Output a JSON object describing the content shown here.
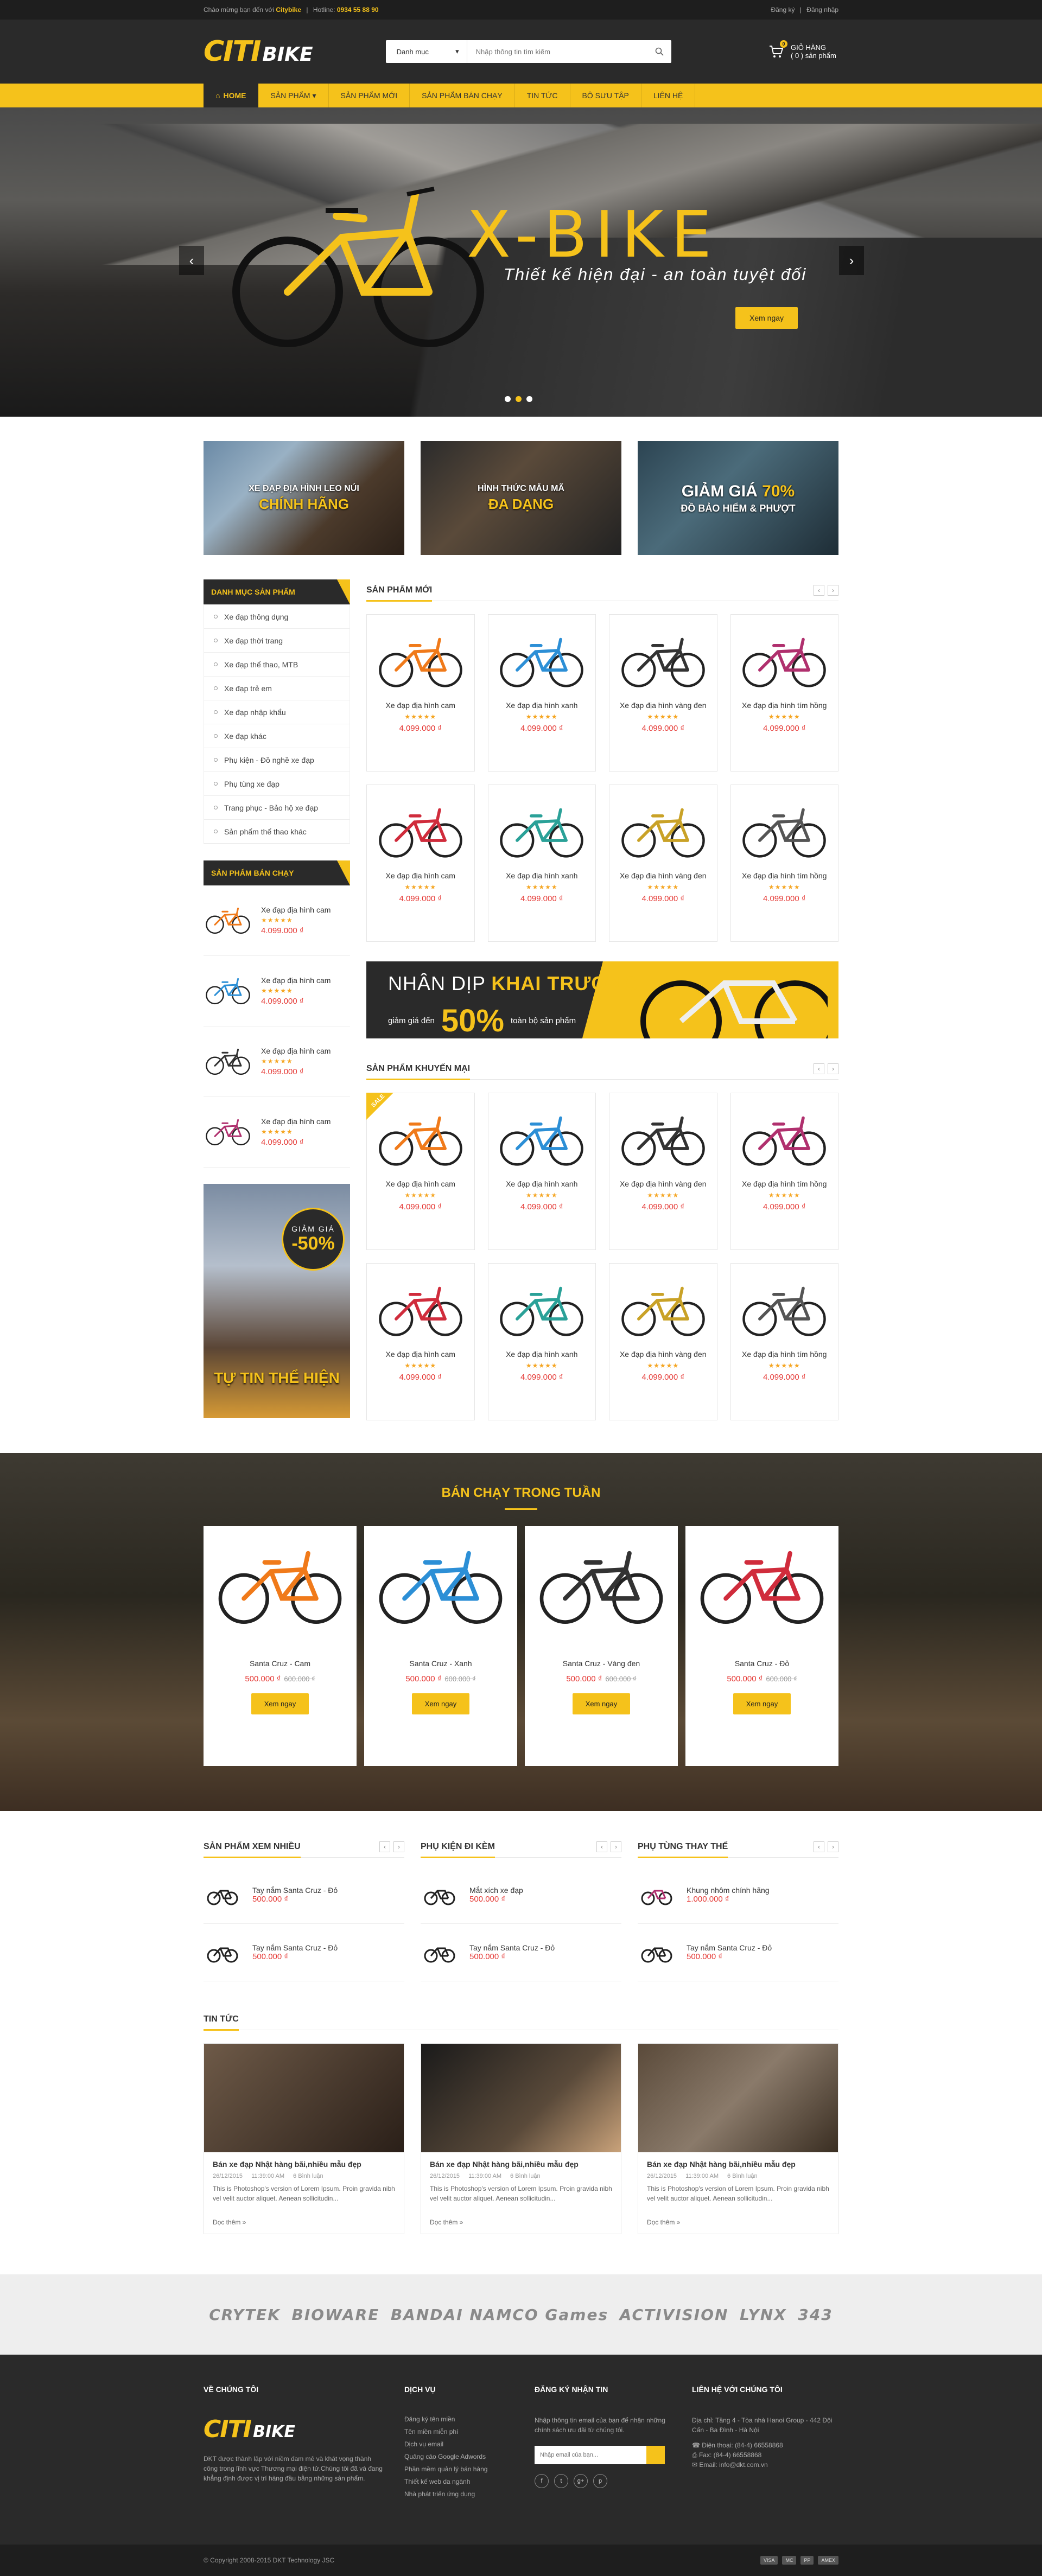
{
  "topbar": {
    "welcome": "Chào mừng bạn đến với ",
    "brand": "Citybike",
    "hotline_label": "Hotline: ",
    "hotline": "0934 55 88 90",
    "login": "Đăng ký",
    "register": "Đăng nhập"
  },
  "header": {
    "logo_a": "CITI",
    "logo_b": "BIKE",
    "search_category": "Danh mục",
    "search_placeholder": "Nhập thông tin tìm kiếm",
    "cart_title": "GIỎ HÀNG",
    "cart_count_text": "( 0 ) sản phẩm",
    "cart_badge": "0"
  },
  "nav": [
    "HOME",
    "SẢN PHẨM ▾",
    "SẢN PHẨM MỚI",
    "SẢN PHẨM BÁN CHẠY",
    "TIN TỨC",
    "BỘ SƯU TẬP",
    "LIÊN HỆ"
  ],
  "hero": {
    "title": "X-BIKE",
    "subtitle": "Thiết kế hiện đại - an toàn tuyệt đối",
    "button": "Xem ngay"
  },
  "banners": [
    {
      "line1": "XE ĐẠP ĐỊA HÌNH LEO NÚI",
      "line2": "CHÍNH HÃNG"
    },
    {
      "line1": "HÌNH THỨC MẪU MÃ",
      "line2": "ĐA DẠNG"
    },
    {
      "line1a": "GIẢM GIÁ ",
      "line1b": "70%",
      "line2": "ĐỒ BẢO HIỂM & PHƯỢT"
    }
  ],
  "sidebar": {
    "cat_title": "DANH MỤC SẢN PHẨM",
    "categories": [
      "Xe đạp thông dụng",
      "Xe đạp thời trang",
      "Xe đạp thể thao, MTB",
      "Xe đạp trẻ em",
      "Xe đạp nhập khẩu",
      "Xe đạp khác",
      "Phụ kiện - Đồ nghề xe đạp",
      "Phụ tùng xe đạp",
      "Trang phục - Bảo hộ xe đạp",
      "Sản phẩm thể thao khác"
    ],
    "best_title": "SẢN PHẨM BÁN CHẠY",
    "best": [
      {
        "name": "Xe đạp địa hình cam",
        "price": "4.099.000 ₫"
      },
      {
        "name": "Xe đạp địa hình cam",
        "price": "4.099.000 ₫"
      },
      {
        "name": "Xe đạp địa hình cam",
        "price": "4.099.000 ₫"
      },
      {
        "name": "Xe đạp địa hình cam",
        "price": "4.099.000 ₫"
      }
    ],
    "ad_badge_a": "GIẢM GIÁ",
    "ad_badge_b": "-50%",
    "ad_caption": "TỰ TIN THỂ HIỆN"
  },
  "new_products": {
    "title": "SẢN PHẨM MỚI",
    "items": [
      {
        "name": "Xe đạp địa hình cam",
        "price": "4.099.000 ₫"
      },
      {
        "name": "Xe đạp địa hình xanh",
        "price": "4.099.000 ₫"
      },
      {
        "name": "Xe đạp địa hình vàng đen",
        "price": "4.099.000 ₫"
      },
      {
        "name": "Xe đạp địa hình tím hồng",
        "price": "4.099.000 ₫"
      },
      {
        "name": "Xe đạp địa hình cam",
        "price": "4.099.000 ₫"
      },
      {
        "name": "Xe đạp địa hình xanh",
        "price": "4.099.000 ₫"
      },
      {
        "name": "Xe đạp địa hình vàng đen",
        "price": "4.099.000 ₫"
      },
      {
        "name": "Xe đạp địa hình tím hồng",
        "price": "4.099.000 ₫"
      }
    ]
  },
  "promo": {
    "line_a": "NHÂN DỊP ",
    "line_b": "KHAI TRƯƠNG",
    "small_a": "giảm giá đến",
    "big": "50%",
    "small_b": "toàn bộ sản phẩm"
  },
  "sale_products": {
    "title": "SẢN PHẨM KHUYẾN MẠI",
    "badge": "SALE",
    "items": [
      {
        "name": "Xe đạp địa hình cam",
        "price": "4.099.000 ₫"
      },
      {
        "name": "Xe đạp địa hình xanh",
        "price": "4.099.000 ₫"
      },
      {
        "name": "Xe đạp địa hình vàng đen",
        "price": "4.099.000 ₫"
      },
      {
        "name": "Xe đạp địa hình tím hồng",
        "price": "4.099.000 ₫"
      },
      {
        "name": "Xe đạp địa hình cam",
        "price": "4.099.000 ₫"
      },
      {
        "name": "Xe đạp địa hình xanh",
        "price": "4.099.000 ₫"
      },
      {
        "name": "Xe đạp địa hình vàng đen",
        "price": "4.099.000 ₫"
      },
      {
        "name": "Xe đạp địa hình tím hồng",
        "price": "4.099.000 ₫"
      }
    ]
  },
  "weekly": {
    "title": "BÁN CHẠY TRONG TUẦN",
    "button": "Xem ngay",
    "items": [
      {
        "name": "Santa Cruz - Cam",
        "price": "500.000 ₫",
        "old": "600.000 ₫"
      },
      {
        "name": "Santa Cruz - Xanh",
        "price": "500.000 ₫",
        "old": "600.000 ₫"
      },
      {
        "name": "Santa Cruz - Vàng đen",
        "price": "500.000 ₫",
        "old": "600.000 ₫"
      },
      {
        "name": "Santa Cruz - Đỏ",
        "price": "500.000 ₫",
        "old": "600.000 ₫"
      }
    ]
  },
  "mini_cols": [
    {
      "title": "SẢN PHẨM XEM NHIỀU",
      "items": [
        {
          "name": "Tay nắm Santa Cruz - Đỏ",
          "price": "500.000 ₫"
        },
        {
          "name": "Tay nắm Santa Cruz - Đỏ",
          "price": "500.000 ₫"
        }
      ]
    },
    {
      "title": "PHỤ KIỆN ĐI KÈM",
      "items": [
        {
          "name": "Mắt xích xe đạp",
          "price": "500.000 ₫"
        },
        {
          "name": "Tay nắm Santa Cruz - Đỏ",
          "price": "500.000 ₫"
        }
      ]
    },
    {
      "title": "PHỤ TÙNG THAY THẾ",
      "items": [
        {
          "name": "Khung nhôm chính hãng",
          "price": "1.000.000 ₫"
        },
        {
          "name": "Tay nắm Santa Cruz - Đỏ",
          "price": "500.000 ₫"
        }
      ]
    }
  ],
  "news": {
    "title": "TIN TỨC",
    "items": [
      {
        "title": "Bán xe đạp Nhật hàng bãi,nhiều mẫu đẹp",
        "date": "26/12/2015",
        "time": "11:39:00 AM",
        "views": "6 Bình luận",
        "excerpt": "This is Photoshop's version of Lorem Ipsum. Proin gravida nibh vel velit auctor aliquet. Aenean sollicitudin...",
        "more": "Đọc thêm »"
      },
      {
        "title": "Bán xe đạp Nhật hàng bãi,nhiều mẫu đẹp",
        "date": "26/12/2015",
        "time": "11:39:00 AM",
        "views": "6 Bình luận",
        "excerpt": "This is Photoshop's version of Lorem Ipsum. Proin gravida nibh vel velit auctor aliquet. Aenean sollicitudin...",
        "more": "Đọc thêm »"
      },
      {
        "title": "Bán xe đạp Nhật hàng bãi,nhiều mẫu đẹp",
        "date": "26/12/2015",
        "time": "11:39:00 AM",
        "views": "6 Bình luận",
        "excerpt": "This is Photoshop's version of Lorem Ipsum. Proin gravida nibh vel velit auctor aliquet. Aenean sollicitudin...",
        "more": "Đọc thêm »"
      }
    ]
  },
  "partners": [
    "CRYTEK",
    "BIOWARE",
    "BANDAI NAMCO Games",
    "ACTIVISION",
    "LYNX",
    "343"
  ],
  "footer": {
    "about_title": "VỀ CHÚNG TÔI",
    "about_text": "DKT được thành lập với niềm đam mê và khát vọng thành công trong lĩnh vực Thương mại điện tử.Chúng tôi đã và đang khẳng định được vị trí hàng đầu bằng những sản phẩm.",
    "service_title": "DỊCH VỤ",
    "services": [
      "Đăng ký tên miền",
      "Tên miền miễn phí",
      "Dịch vụ email",
      "Quảng cáo Google Adwords",
      "Phần mềm quản lý bán hàng",
      "Thiết kế web da ngành",
      "Nhà phát triển ứng dụng"
    ],
    "nl_title": "ĐĂNG KÝ NHẬN TIN",
    "nl_text": "Nhập thông tin email của bạn để nhận những chính sách ưu đãi từ chúng tôi.",
    "nl_placeholder": "Nhập email của bạn...",
    "contact_title": "LIÊN HỆ VỚI CHÚNG TÔI",
    "contact_addr": "Địa chỉ: Tầng 4 - Tòa nhà Hanoi Group - 442 Đội Cấn - Ba Đình - Hà Nội",
    "contact_hotline": "Điện thoại: (84-4) 66558868",
    "contact_fax": "Fax: (84-4) 66558868",
    "contact_email": "Email: info@dkt.com.vn",
    "copyright": "© Copyright 2008-2015 DKT Technology JSC"
  },
  "colors": {
    "accent": "#f5c21b",
    "dark": "#2a2a2a",
    "price": "#e53935"
  }
}
